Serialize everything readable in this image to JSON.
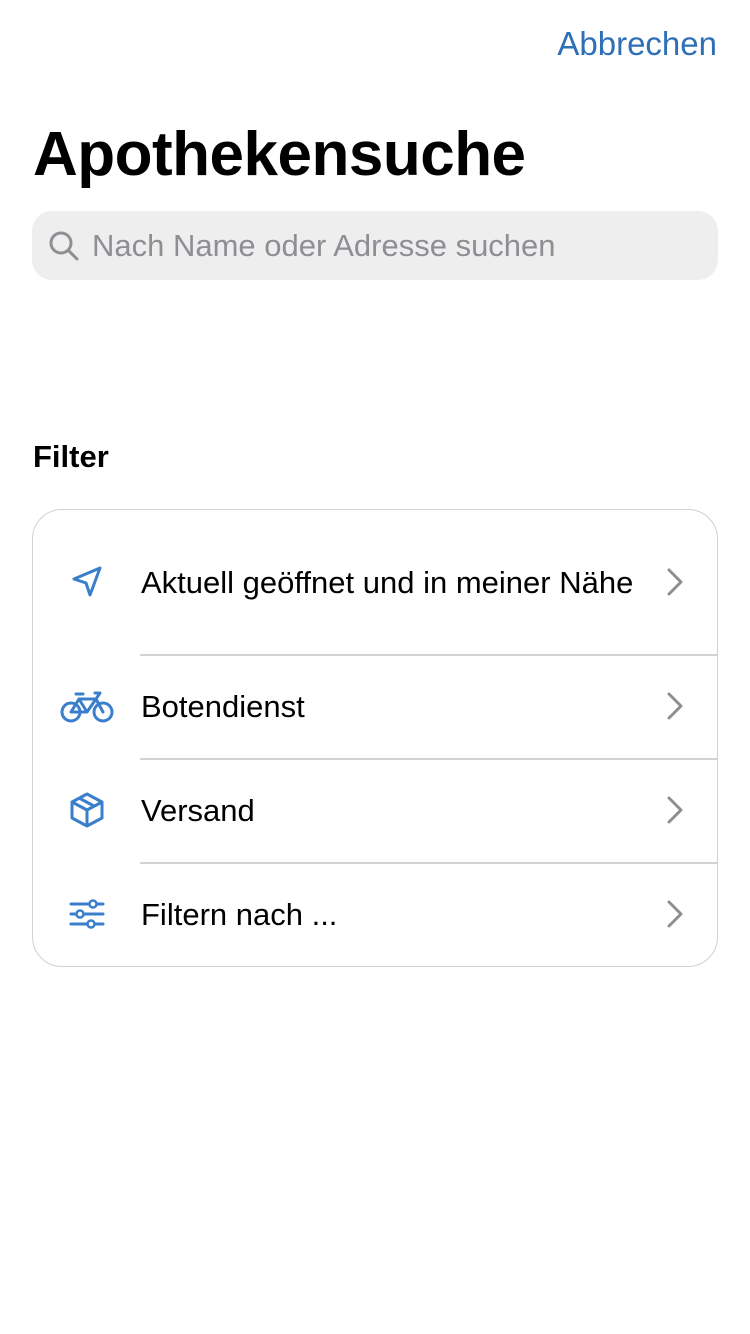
{
  "header": {
    "cancel_label": "Abbrechen",
    "title": "Apothekensuche"
  },
  "search": {
    "placeholder": "Nach Name oder Adresse suchen",
    "value": "",
    "icon": "search-icon"
  },
  "filter_section": {
    "title": "Filter",
    "items": [
      {
        "label": "Aktuell geöffnet und in meiner Nähe",
        "icon": "location-arrow-icon"
      },
      {
        "label": "Botendienst",
        "icon": "bicycle-icon"
      },
      {
        "label": "Versand",
        "icon": "package-icon"
      },
      {
        "label": "Filtern nach ...",
        "icon": "sliders-icon"
      }
    ]
  },
  "colors": {
    "accent": "#2f6fb6",
    "icon_blue": "#3a7fcb",
    "search_bg": "#eeeeef",
    "separator": "#d1d1d6",
    "chevron": "#8e8e93"
  }
}
